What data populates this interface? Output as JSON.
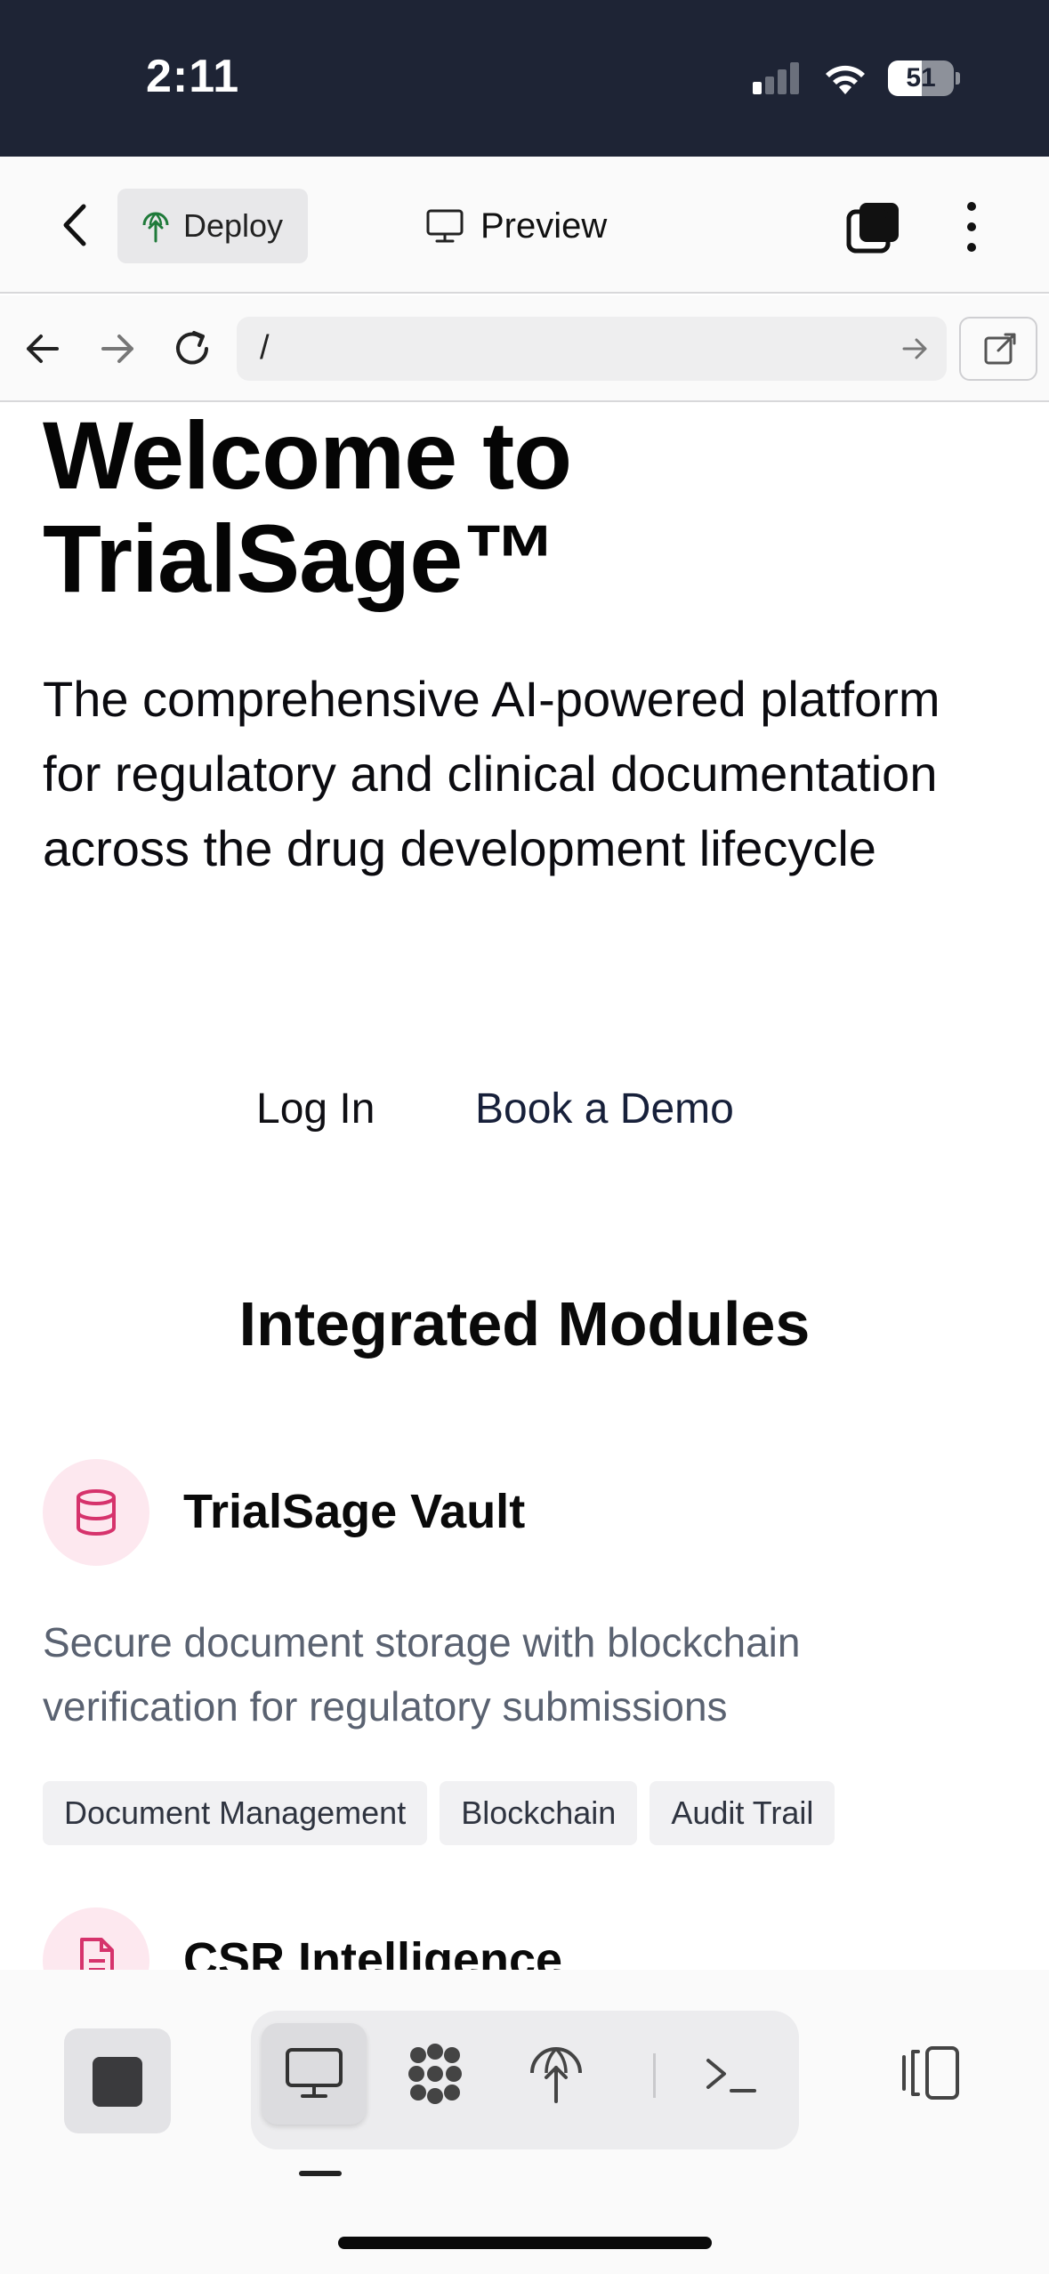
{
  "status_bar": {
    "time": "2:11",
    "battery_percent": "51",
    "battery_level": 0.51,
    "signal_bars_active": 1
  },
  "header": {
    "deploy_label": "Deploy",
    "preview_label": "Preview"
  },
  "browser": {
    "url": "/"
  },
  "hero": {
    "title": "Welcome to TrialSage™",
    "subtitle": "The comprehensive AI-powered platform for regulatory and clinical documentation across the drug development lifecycle",
    "login_label": "Log In",
    "demo_label": "Book a Demo"
  },
  "modules": {
    "section_title": "Integrated Modules",
    "items": [
      {
        "icon": "database-icon",
        "title": "TrialSage Vault",
        "description": "Secure document storage with blockchain verification for regulatory submissions",
        "tags": [
          "Document Management",
          "Blockchain",
          "Audit Trail"
        ]
      },
      {
        "icon": "file-text-icon",
        "title": "CSR Intelligence"
      }
    ]
  },
  "colors": {
    "status_bar_bg": "#1e2435",
    "module_icon_bg": "#fde8ef",
    "module_icon_color": "#d6336c",
    "muted_text": "#5a6271"
  }
}
